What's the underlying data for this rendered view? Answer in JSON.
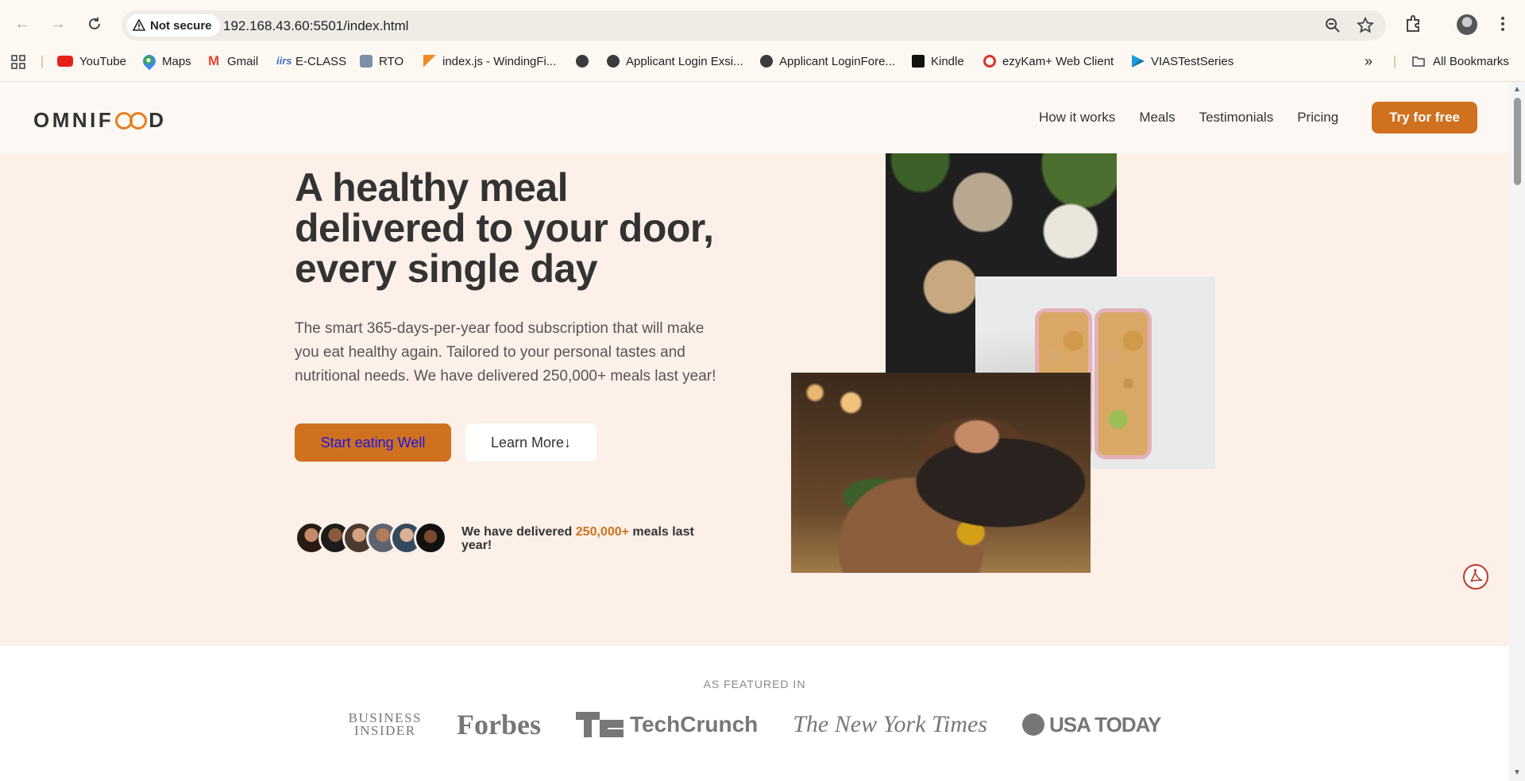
{
  "browser": {
    "security_label": "Not secure",
    "url": "192.168.43.60:5501/index.html",
    "bookmarks": [
      {
        "label": "YouTube",
        "icon": "youtube-icon"
      },
      {
        "label": "Maps",
        "icon": "maps-icon"
      },
      {
        "label": "Gmail",
        "icon": "gmail-icon"
      },
      {
        "label": "E-CLASS",
        "icon": "eclass-icon"
      },
      {
        "label": "RTO",
        "icon": "rto-icon"
      },
      {
        "label": "index.js - WindingFi...",
        "icon": "codesandbox-icon"
      },
      {
        "label": "",
        "icon": "globe-icon"
      },
      {
        "label": "Applicant Login Exsi...",
        "icon": "globe-icon"
      },
      {
        "label": "Applicant LoginFore...",
        "icon": "globe-icon"
      },
      {
        "label": "Kindle",
        "icon": "kindle-icon"
      },
      {
        "label": "ezyKam+ Web Client",
        "icon": "ezykam-icon"
      },
      {
        "label": "VIASTestSeries",
        "icon": "vias-icon"
      }
    ],
    "all_bookmarks": "All Bookmarks"
  },
  "site": {
    "logo": {
      "before": "OMNIF",
      "after": "D"
    },
    "nav": [
      "How it works",
      "Meals",
      "Testimonials",
      "Pricing"
    ],
    "cta": "Try for free"
  },
  "hero": {
    "title": "A healthy meal delivered to your door, every single day",
    "description": "The smart 365-days-per-year food subscription that will make you eat healthy again. Tailored to your personal tastes and nutritional needs. We have delivered 250,000+ meals last year!",
    "primary_button": "Start eating Well",
    "secondary_button": "Learn More↓",
    "delivered_prefix": "We have delivered",
    "delivered_highlight": "250,000+",
    "delivered_suffix": "meals last year!"
  },
  "featured": {
    "title": "AS FEATURED IN",
    "logos": {
      "business_insider_1": "BUSINESS",
      "business_insider_2": "INSIDER",
      "forbes": "Forbes",
      "techcrunch": "TechCrunch",
      "nyt": "The New York Times",
      "usatoday": "USA TODAY"
    }
  },
  "colors": {
    "brand": "#cf711f",
    "hero_bg": "#fcf0e8",
    "header_bg": "#fdf8f3"
  }
}
